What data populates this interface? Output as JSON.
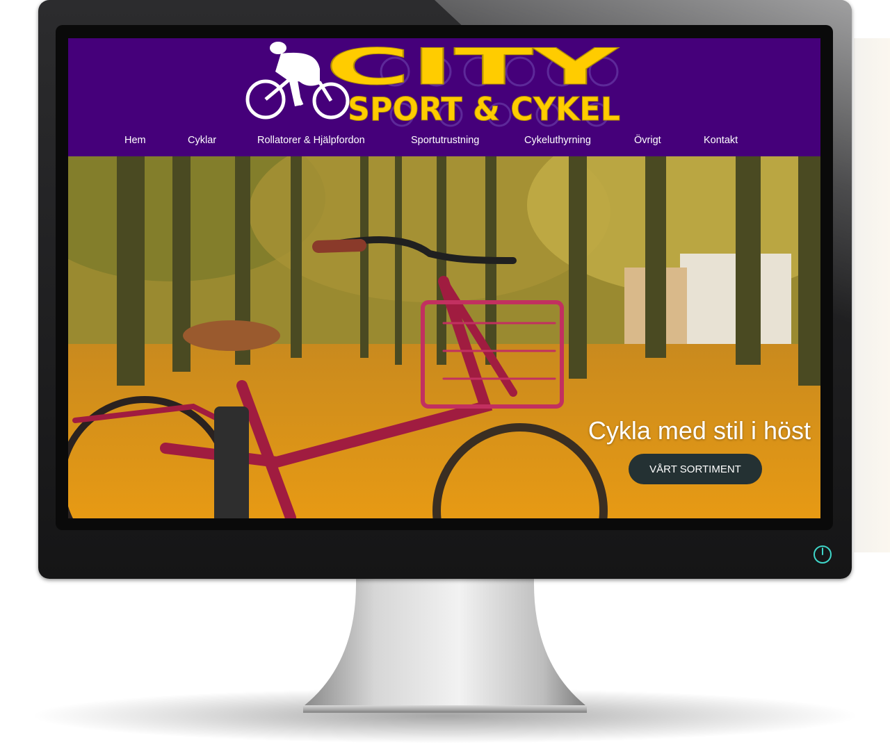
{
  "site": {
    "logo": {
      "line1": "CITY",
      "line2": "SPORT & CYKEL"
    },
    "nav": [
      {
        "label": "Hem"
      },
      {
        "label": "Cyklar"
      },
      {
        "label": "Rollatorer & Hjälpfordon"
      },
      {
        "label": "Sportutrustning"
      },
      {
        "label": "Cykeluthyrning"
      },
      {
        "label": "Övrigt"
      },
      {
        "label": "Kontakt"
      }
    ],
    "hero": {
      "title": "Cykla med stil i höst",
      "button_label": "VÅRT SORTIMENT"
    }
  },
  "colors": {
    "header_bg": "#45007a",
    "logo_yellow": "#ffcc00",
    "button_bg": "#243133",
    "power_accent": "#3fd6c9"
  },
  "icons": {
    "power": "power-icon",
    "cyclist": "cyclist-logo-icon"
  }
}
